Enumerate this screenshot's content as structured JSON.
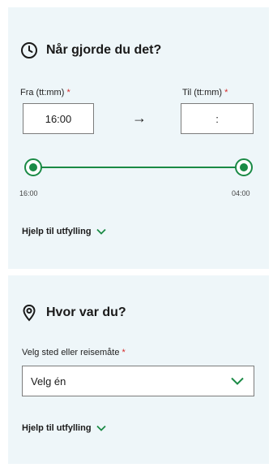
{
  "time_section": {
    "title": "Når gjorde du det?",
    "from_label": "Fra (tt:mm)",
    "from_value": "16:00",
    "to_label": "Til (tt:mm)",
    "to_value": ":",
    "required_mark": "*",
    "arrow": "→",
    "slider": {
      "start_label": "16:00",
      "end_label": "04:00"
    },
    "help_label": "Hjelp til utfylling"
  },
  "place_section": {
    "title": "Hvor var du?",
    "select_label": "Velg sted eller reisemåte",
    "required_mark": "*",
    "select_value": "Velg én",
    "help_label": "Hjelp til utfylling"
  },
  "colors": {
    "accent": "#1a8a45",
    "required": "#d62c2c",
    "card_bg": "#eef6f9"
  }
}
